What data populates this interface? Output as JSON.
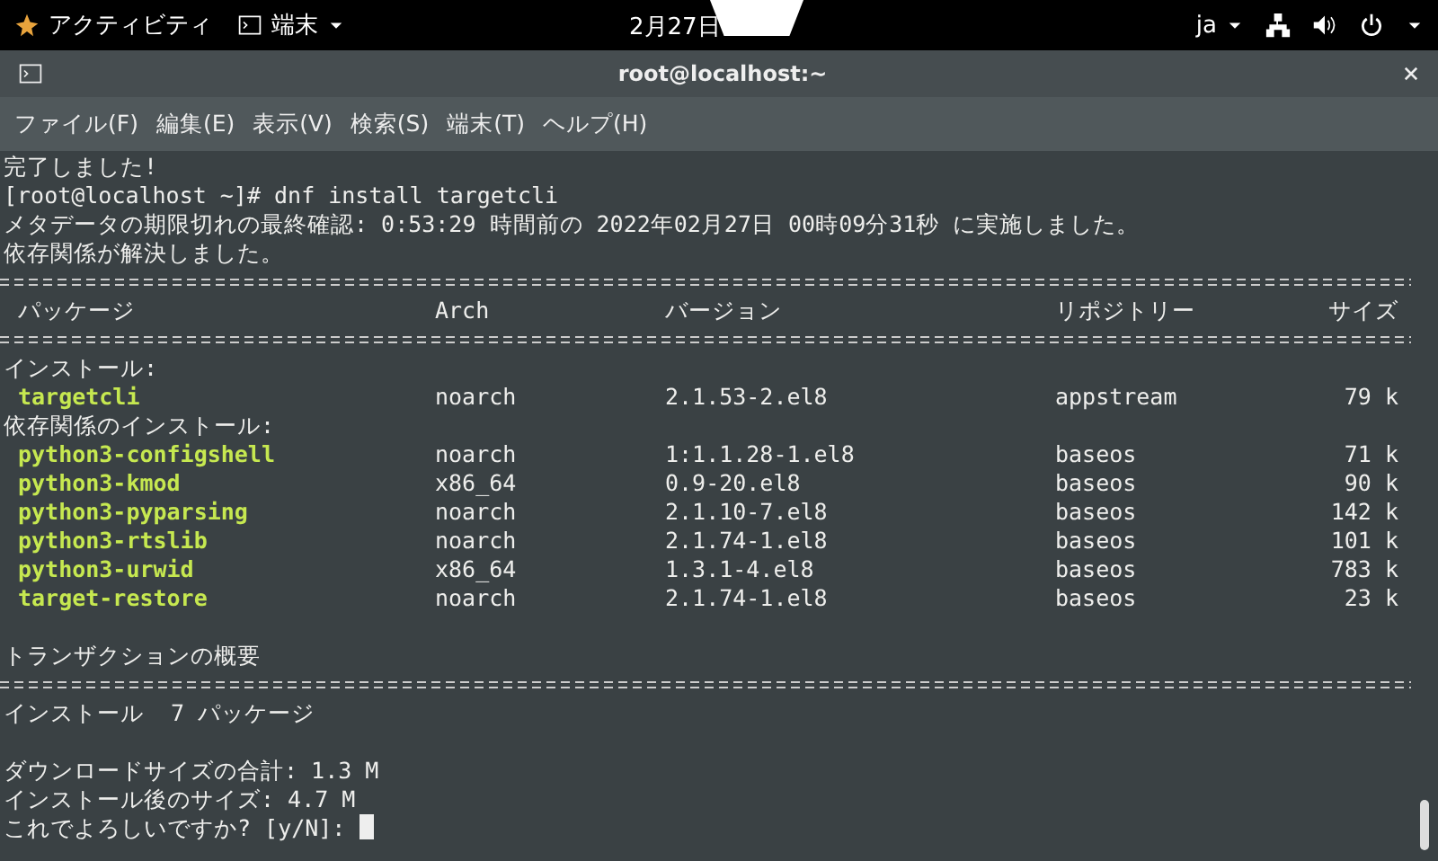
{
  "topbar": {
    "activities": "アクティビティ",
    "app_menu": "端末",
    "clock": "2月27日",
    "input_source": "ja"
  },
  "window": {
    "title": "root@localhost:~"
  },
  "menu": [
    "ファイル(F)",
    "編集(E)",
    "表示(V)",
    "検索(S)",
    "端末(T)",
    "ヘルプ(H)"
  ],
  "terminal": {
    "lines": [
      {
        "kind": "text",
        "text": "完了しました!"
      },
      {
        "kind": "text",
        "text": "[root@localhost ~]# dnf install targetcli"
      },
      {
        "kind": "text",
        "text": "メタデータの期限切れの最終確認: 0:53:29 時間前の 2022年02月27日 00時09分31秒 に実施しました。"
      },
      {
        "kind": "text",
        "text": "依存関係が解決しました。"
      },
      {
        "kind": "rule"
      },
      {
        "kind": "header",
        "cells": [
          "パッケージ",
          "Arch",
          "バージョン",
          "リポジトリー",
          "サイズ"
        ]
      },
      {
        "kind": "rule"
      },
      {
        "kind": "text",
        "text": "インストール:"
      },
      {
        "kind": "package",
        "cells": [
          "targetcli",
          "noarch",
          "2.1.53-2.el8",
          "appstream",
          "79 k"
        ]
      },
      {
        "kind": "text",
        "text": "依存関係のインストール:"
      },
      {
        "kind": "package",
        "cells": [
          "python3-configshell",
          "noarch",
          "1:1.1.28-1.el8",
          "baseos",
          "71 k"
        ]
      },
      {
        "kind": "package",
        "cells": [
          "python3-kmod",
          "x86_64",
          "0.9-20.el8",
          "baseos",
          "90 k"
        ]
      },
      {
        "kind": "package",
        "cells": [
          "python3-pyparsing",
          "noarch",
          "2.1.10-7.el8",
          "baseos",
          "142 k"
        ]
      },
      {
        "kind": "package",
        "cells": [
          "python3-rtslib",
          "noarch",
          "2.1.74-1.el8",
          "baseos",
          "101 k"
        ]
      },
      {
        "kind": "package",
        "cells": [
          "python3-urwid",
          "x86_64",
          "1.3.1-4.el8",
          "baseos",
          "783 k"
        ]
      },
      {
        "kind": "package",
        "cells": [
          "target-restore",
          "noarch",
          "2.1.74-1.el8",
          "baseos",
          "23 k"
        ]
      },
      {
        "kind": "blank"
      },
      {
        "kind": "text",
        "text": "トランザクションの概要"
      },
      {
        "kind": "rule"
      },
      {
        "kind": "text",
        "text": "インストール  7 パッケージ"
      },
      {
        "kind": "blank"
      },
      {
        "kind": "text",
        "text": "ダウンロードサイズの合計: 1.3 M"
      },
      {
        "kind": "text",
        "text": "インストール後のサイズ: 4.7 M"
      },
      {
        "kind": "prompt",
        "text": "これでよろしいですか? [y/N]: "
      }
    ]
  }
}
